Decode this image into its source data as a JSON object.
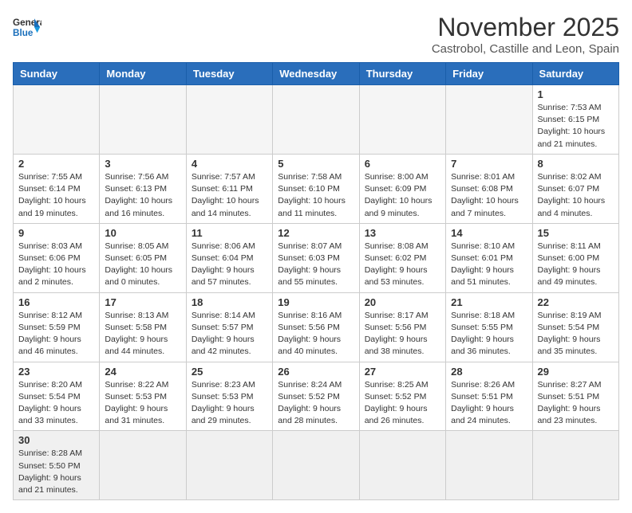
{
  "header": {
    "logo_general": "General",
    "logo_blue": "Blue",
    "month_title": "November 2025",
    "location": "Castrobol, Castille and Leon, Spain"
  },
  "days_of_week": [
    "Sunday",
    "Monday",
    "Tuesday",
    "Wednesday",
    "Thursday",
    "Friday",
    "Saturday"
  ],
  "weeks": [
    [
      {
        "day": "",
        "info": ""
      },
      {
        "day": "",
        "info": ""
      },
      {
        "day": "",
        "info": ""
      },
      {
        "day": "",
        "info": ""
      },
      {
        "day": "",
        "info": ""
      },
      {
        "day": "",
        "info": ""
      },
      {
        "day": "1",
        "info": "Sunrise: 7:53 AM\nSunset: 6:15 PM\nDaylight: 10 hours and 21 minutes."
      }
    ],
    [
      {
        "day": "2",
        "info": "Sunrise: 7:55 AM\nSunset: 6:14 PM\nDaylight: 10 hours and 19 minutes."
      },
      {
        "day": "3",
        "info": "Sunrise: 7:56 AM\nSunset: 6:13 PM\nDaylight: 10 hours and 16 minutes."
      },
      {
        "day": "4",
        "info": "Sunrise: 7:57 AM\nSunset: 6:11 PM\nDaylight: 10 hours and 14 minutes."
      },
      {
        "day": "5",
        "info": "Sunrise: 7:58 AM\nSunset: 6:10 PM\nDaylight: 10 hours and 11 minutes."
      },
      {
        "day": "6",
        "info": "Sunrise: 8:00 AM\nSunset: 6:09 PM\nDaylight: 10 hours and 9 minutes."
      },
      {
        "day": "7",
        "info": "Sunrise: 8:01 AM\nSunset: 6:08 PM\nDaylight: 10 hours and 7 minutes."
      },
      {
        "day": "8",
        "info": "Sunrise: 8:02 AM\nSunset: 6:07 PM\nDaylight: 10 hours and 4 minutes."
      }
    ],
    [
      {
        "day": "9",
        "info": "Sunrise: 8:03 AM\nSunset: 6:06 PM\nDaylight: 10 hours and 2 minutes."
      },
      {
        "day": "10",
        "info": "Sunrise: 8:05 AM\nSunset: 6:05 PM\nDaylight: 10 hours and 0 minutes."
      },
      {
        "day": "11",
        "info": "Sunrise: 8:06 AM\nSunset: 6:04 PM\nDaylight: 9 hours and 57 minutes."
      },
      {
        "day": "12",
        "info": "Sunrise: 8:07 AM\nSunset: 6:03 PM\nDaylight: 9 hours and 55 minutes."
      },
      {
        "day": "13",
        "info": "Sunrise: 8:08 AM\nSunset: 6:02 PM\nDaylight: 9 hours and 53 minutes."
      },
      {
        "day": "14",
        "info": "Sunrise: 8:10 AM\nSunset: 6:01 PM\nDaylight: 9 hours and 51 minutes."
      },
      {
        "day": "15",
        "info": "Sunrise: 8:11 AM\nSunset: 6:00 PM\nDaylight: 9 hours and 49 minutes."
      }
    ],
    [
      {
        "day": "16",
        "info": "Sunrise: 8:12 AM\nSunset: 5:59 PM\nDaylight: 9 hours and 46 minutes."
      },
      {
        "day": "17",
        "info": "Sunrise: 8:13 AM\nSunset: 5:58 PM\nDaylight: 9 hours and 44 minutes."
      },
      {
        "day": "18",
        "info": "Sunrise: 8:14 AM\nSunset: 5:57 PM\nDaylight: 9 hours and 42 minutes."
      },
      {
        "day": "19",
        "info": "Sunrise: 8:16 AM\nSunset: 5:56 PM\nDaylight: 9 hours and 40 minutes."
      },
      {
        "day": "20",
        "info": "Sunrise: 8:17 AM\nSunset: 5:56 PM\nDaylight: 9 hours and 38 minutes."
      },
      {
        "day": "21",
        "info": "Sunrise: 8:18 AM\nSunset: 5:55 PM\nDaylight: 9 hours and 36 minutes."
      },
      {
        "day": "22",
        "info": "Sunrise: 8:19 AM\nSunset: 5:54 PM\nDaylight: 9 hours and 35 minutes."
      }
    ],
    [
      {
        "day": "23",
        "info": "Sunrise: 8:20 AM\nSunset: 5:54 PM\nDaylight: 9 hours and 33 minutes."
      },
      {
        "day": "24",
        "info": "Sunrise: 8:22 AM\nSunset: 5:53 PM\nDaylight: 9 hours and 31 minutes."
      },
      {
        "day": "25",
        "info": "Sunrise: 8:23 AM\nSunset: 5:53 PM\nDaylight: 9 hours and 29 minutes."
      },
      {
        "day": "26",
        "info": "Sunrise: 8:24 AM\nSunset: 5:52 PM\nDaylight: 9 hours and 28 minutes."
      },
      {
        "day": "27",
        "info": "Sunrise: 8:25 AM\nSunset: 5:52 PM\nDaylight: 9 hours and 26 minutes."
      },
      {
        "day": "28",
        "info": "Sunrise: 8:26 AM\nSunset: 5:51 PM\nDaylight: 9 hours and 24 minutes."
      },
      {
        "day": "29",
        "info": "Sunrise: 8:27 AM\nSunset: 5:51 PM\nDaylight: 9 hours and 23 minutes."
      }
    ],
    [
      {
        "day": "30",
        "info": "Sunrise: 8:28 AM\nSunset: 5:50 PM\nDaylight: 9 hours and 21 minutes."
      },
      {
        "day": "",
        "info": ""
      },
      {
        "day": "",
        "info": ""
      },
      {
        "day": "",
        "info": ""
      },
      {
        "day": "",
        "info": ""
      },
      {
        "day": "",
        "info": ""
      },
      {
        "day": "",
        "info": ""
      }
    ]
  ]
}
